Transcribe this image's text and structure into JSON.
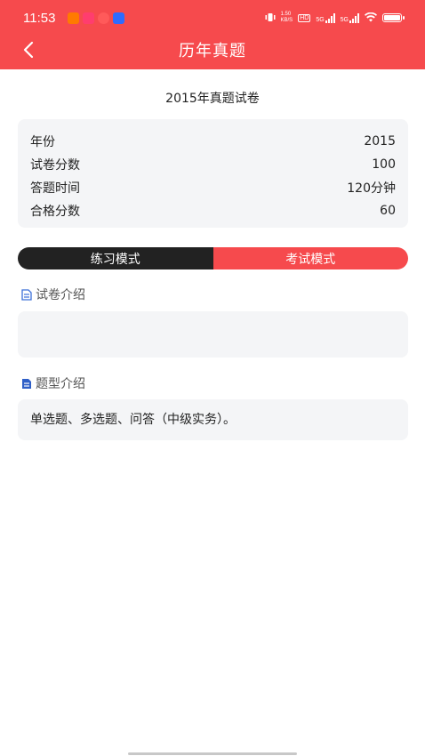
{
  "status": {
    "time": "11:53",
    "net_speed": "1.50\nKB/S",
    "hd": "HD",
    "sig1_label": "5G",
    "sig2_label": "5G",
    "app_colors": [
      "#ff7a00",
      "#ff3d6e",
      "#ff5a5a",
      "#2f6bff"
    ]
  },
  "nav": {
    "title": "历年真题"
  },
  "paper": {
    "title": "2015年真题试卷",
    "rows": [
      {
        "label": "年份",
        "value": "2015"
      },
      {
        "label": "试卷分数",
        "value": "100"
      },
      {
        "label": "答题时间",
        "value": "120分钟"
      },
      {
        "label": "合格分数",
        "value": "60"
      }
    ]
  },
  "modes": {
    "practice": "练习模式",
    "exam": "考试模式",
    "selected": "exam"
  },
  "sections": {
    "paper_intro": {
      "title": "试卷介绍",
      "content": ""
    },
    "question_intro": {
      "title": "题型介绍",
      "content": "单选题、多选题、问答（中级实务）。"
    }
  },
  "colors": {
    "accent": "#f64a4d",
    "dark": "#222222",
    "card_bg": "#f4f5f7",
    "icon_blue": "#3b6fd8"
  }
}
